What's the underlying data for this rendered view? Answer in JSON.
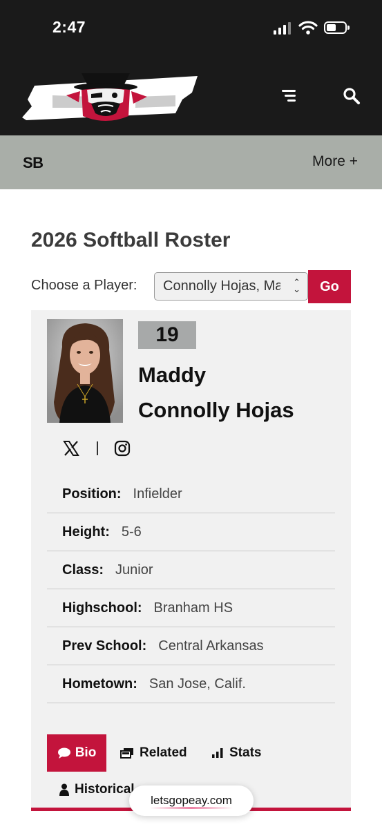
{
  "status_bar": {
    "time": "2:47"
  },
  "nav": {
    "sport": "SB",
    "more_label": "More +"
  },
  "page": {
    "title": "2026 Softball Roster"
  },
  "chooser": {
    "label": "Choose a Player:",
    "selected_value": "Connolly Hojas, Maddy",
    "go_label": "Go"
  },
  "player": {
    "number": "19",
    "first_name": "Maddy",
    "last_name": "Connolly Hojas",
    "facts": [
      {
        "label": "Position:",
        "value": "Infielder"
      },
      {
        "label": "Height:",
        "value": "5-6"
      },
      {
        "label": "Class:",
        "value": "Junior"
      },
      {
        "label": "Highschool:",
        "value": "Branham HS"
      },
      {
        "label": "Prev School:",
        "value": "Central Arkansas"
      },
      {
        "label": "Hometown:",
        "value": "San Jose, Calif."
      }
    ]
  },
  "tabs": [
    {
      "label": "Bio",
      "icon": "speech-bubble-icon",
      "active": true
    },
    {
      "label": "Related",
      "icon": "stacked-cards-icon"
    },
    {
      "label": "Stats",
      "icon": "bar-chart-icon"
    },
    {
      "label": "Historical",
      "icon": "person-icon"
    }
  ],
  "browser": {
    "url": "letsgopeay.com"
  },
  "colors": {
    "accent": "#c3143c",
    "header_bg": "#1a1a1a",
    "subnav_bg": "#a9aea8",
    "card_bg": "#f1f1f1"
  }
}
